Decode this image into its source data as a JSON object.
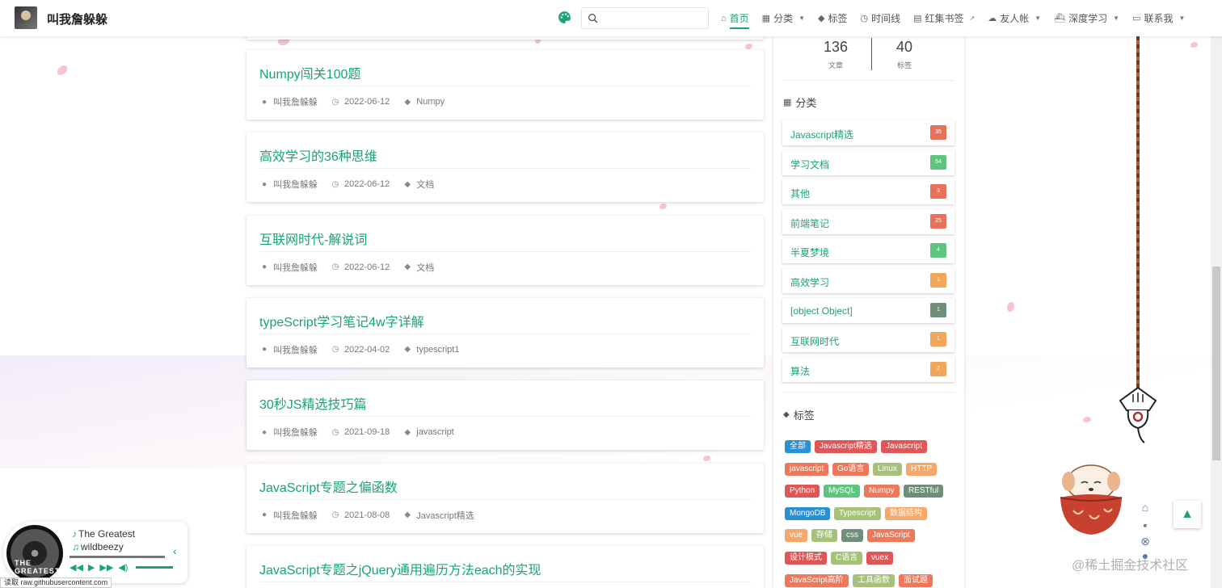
{
  "header": {
    "site_title": "叫我詹躲躲",
    "search": {
      "value": "",
      "placeholder": ""
    },
    "nav": [
      {
        "icon": "home-icon",
        "glyph": "⌂",
        "label": "首页",
        "active": true,
        "dropdown": false
      },
      {
        "icon": "grid-icon",
        "glyph": "▦",
        "label": "分类",
        "active": false,
        "dropdown": true
      },
      {
        "icon": "tag-icon",
        "glyph": "◆",
        "label": "标签",
        "active": false,
        "dropdown": false
      },
      {
        "icon": "clock-icon",
        "glyph": "◷",
        "label": "时间线",
        "active": false,
        "dropdown": false
      },
      {
        "icon": "book-icon",
        "glyph": "▤",
        "label": "红集书签",
        "active": false,
        "dropdown": false,
        "external": true
      },
      {
        "icon": "cloud-icon",
        "glyph": "☁",
        "label": "友人帐",
        "active": false,
        "dropdown": true
      },
      {
        "icon": "ship-icon",
        "glyph": "⛴",
        "label": "深度学习",
        "active": false,
        "dropdown": true
      },
      {
        "icon": "mail-icon",
        "glyph": "▭",
        "label": "联系我",
        "active": false,
        "dropdown": true
      }
    ]
  },
  "posts": [
    {
      "title": "Numpy闯关100题",
      "author": "叫我詹躲躲",
      "date": "2022-06-12",
      "tag": "Numpy"
    },
    {
      "title": "高效学习的36种思维",
      "author": "叫我詹躲躲",
      "date": "2022-06-12",
      "tag": "文档"
    },
    {
      "title": "互联网时代-解说词",
      "author": "叫我詹躲躲",
      "date": "2022-06-12",
      "tag": "文档"
    },
    {
      "title": "typeScript学习笔记4w字详解",
      "author": "叫我詹躲躲",
      "date": "2022-04-02",
      "tag": "typescript1"
    },
    {
      "title": "30秒JS精选技巧篇",
      "author": "叫我詹躲躲",
      "date": "2021-09-18",
      "tag": "javascript"
    },
    {
      "title": "JavaScript专题之偏函数",
      "author": "叫我詹躲躲",
      "date": "2021-08-08",
      "tag": "Javascript精选"
    },
    {
      "title": "JavaScript专题之jQuery通用遍历方法each的实现",
      "author": "",
      "date": "",
      "tag": ""
    }
  ],
  "sidebar": {
    "stats": [
      {
        "value": "136",
        "label": "文章"
      },
      {
        "value": "40",
        "label": "标签"
      }
    ],
    "categories_heading": "分类",
    "categories": [
      {
        "name": "Javascript精选",
        "count": "35",
        "color": "#e8715a"
      },
      {
        "name": "学习文档",
        "count": "64",
        "color": "#5fc47e"
      },
      {
        "name": "其他",
        "count": "3",
        "color": "#e8715a"
      },
      {
        "name": "前端笔记",
        "count": "25",
        "color": "#e8715a"
      },
      {
        "name": "半夏梦境",
        "count": "4",
        "color": "#5fc47e"
      },
      {
        "name": "高效学习",
        "count": "1",
        "color": "#f2a65a"
      },
      {
        "name": "[object Object]",
        "count": "1",
        "color": "#6f8f7a"
      },
      {
        "name": "互联网时代",
        "count": "1",
        "color": "#f2a65a"
      },
      {
        "name": "算法",
        "count": "2",
        "color": "#f2a65a"
      }
    ],
    "tags_heading": "标签",
    "tags": [
      {
        "label": "全部",
        "color": "#2c8fd1"
      },
      {
        "label": "Javascript精选",
        "color": "#e05656"
      },
      {
        "label": "Javascript",
        "color": "#e05656"
      },
      {
        "label": "javascript",
        "color": "#f0785a"
      },
      {
        "label": "Go语言",
        "color": "#f0785a"
      },
      {
        "label": "Linux",
        "color": "#a6c27a"
      },
      {
        "label": "HTTP",
        "color": "#f5a86a"
      },
      {
        "label": "Python",
        "color": "#e05656"
      },
      {
        "label": "MySQL",
        "color": "#5fc47e"
      },
      {
        "label": "Numpy",
        "color": "#f0785a"
      },
      {
        "label": "RESTful",
        "color": "#6f8f7a"
      },
      {
        "label": "MongoDB",
        "color": "#2c8fd1"
      },
      {
        "label": "Typescript",
        "color": "#a6c27a"
      },
      {
        "label": "数据结构",
        "color": "#f5a86a"
      },
      {
        "label": "vue",
        "color": "#f5a86a"
      },
      {
        "label": "存储",
        "color": "#a6c27a"
      },
      {
        "label": "css",
        "color": "#6f8f7a"
      },
      {
        "label": "JavaScript",
        "color": "#f0785a"
      },
      {
        "label": "设计模式",
        "color": "#e05656"
      },
      {
        "label": "C语言",
        "color": "#a6c27a"
      },
      {
        "label": "vuex",
        "color": "#e05656"
      },
      {
        "label": "JavaScript高阶",
        "color": "#f0785a"
      },
      {
        "label": "工具函数",
        "color": "#a6c27a"
      },
      {
        "label": "面试题",
        "color": "#f0785a"
      }
    ]
  },
  "player": {
    "title": "The Greatest",
    "artist": "wildbeezy",
    "disc_text": "THE GREATEST"
  },
  "statusbar": "读取 raw.githubusercontent.com",
  "watermark": "@稀土掘金技术社区",
  "colors": {
    "accent": "#1aa375"
  }
}
